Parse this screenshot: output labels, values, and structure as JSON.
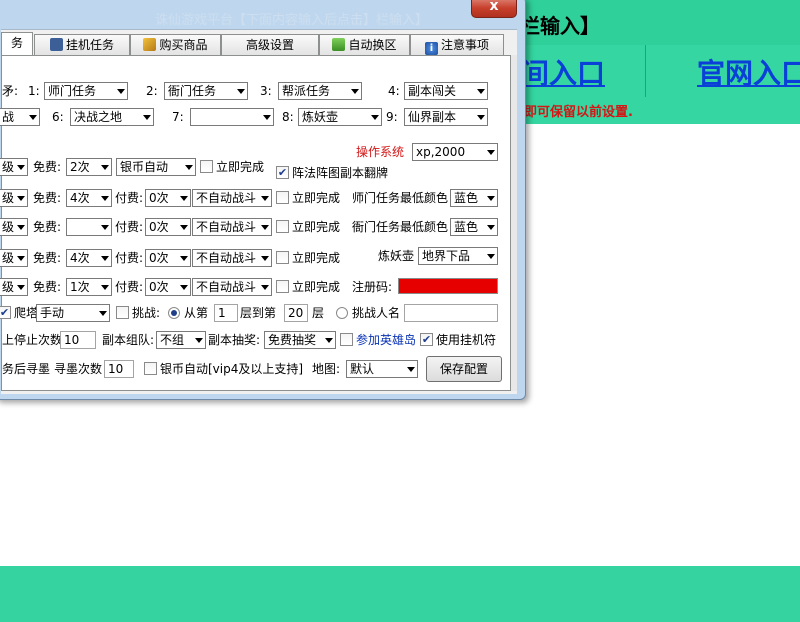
{
  "background": {
    "top_title": "栏输入】",
    "nav_link_1": "间入口",
    "nav_link_2": "官网入口",
    "notice": "即可保留以前设置."
  },
  "window": {
    "title": "诛仙游戏平台【下面内容输入后点击】栏输入】",
    "close_label": "x"
  },
  "tabs": [
    {
      "label": "务",
      "icon": ""
    },
    {
      "label": "挂机任务",
      "icon": "robot-icon"
    },
    {
      "label": "购买商品",
      "icon": "box-icon"
    },
    {
      "label": "高级设置",
      "icon": ""
    },
    {
      "label": "自动换区",
      "icon": "arrow-icon"
    },
    {
      "label": "注意事项",
      "icon": "info-icon"
    }
  ],
  "row1": {
    "prefix": "矛:",
    "n1": "1:",
    "v1": "师门任务",
    "n2": "2:",
    "v2": "衙门任务",
    "n3": "3:",
    "v3": "帮派任务",
    "n4": "4:",
    "v4": "副本闯关"
  },
  "row2": {
    "v5_tail": "战",
    "n6": "6:",
    "v6": "决战之地",
    "n7": "7:",
    "v7": "",
    "n8": "8:",
    "v8": "炼妖壶",
    "n9": "9:",
    "v9": "仙界副本"
  },
  "os": {
    "label": "操作系统",
    "value": "xp,2000"
  },
  "row3": {
    "level": "级",
    "free_label": "免费:",
    "free": "2次",
    "currency": "银币自动",
    "instant": "立即完成",
    "flip_label": "阵法阵图副本翻牌",
    "flip_checked": "✔"
  },
  "row4": {
    "level": "级",
    "free_label": "免费:",
    "free": "4次",
    "paid_label": "付费:",
    "paid": "0次",
    "fight": "不自动战斗",
    "instant": "立即完成",
    "color_label": "师门任务最低颜色",
    "color": "蓝色"
  },
  "row5": {
    "level": "级",
    "free_label": "免费:",
    "free": "",
    "paid_label": "付费:",
    "paid": "0次",
    "fight": "不自动战斗",
    "instant": "立即完成",
    "color_label": "衙门任务最低颜色",
    "color": "蓝色"
  },
  "row6": {
    "level": "级",
    "free_label": "免费:",
    "free": "4次",
    "paid_label": "付费:",
    "paid": "0次",
    "fight": "不自动战斗",
    "instant": "立即完成",
    "pot_label": "炼妖壶",
    "pot": "地界下品"
  },
  "row7": {
    "level": "级",
    "free_label": "免费:",
    "free": "1次",
    "paid_label": "付费:",
    "paid": "0次",
    "fight": "不自动战斗",
    "instant": "立即完成",
    "reg_label": "注册码:"
  },
  "row8": {
    "tower_check": "✔",
    "tower_label": "爬塔",
    "mode": "手动",
    "challenge_label": "挑战:",
    "from_label": "从第",
    "from_value": "1",
    "to_label": "层到第",
    "to_value": "20",
    "floor_label": "层",
    "name_label": "挑战人名",
    "name_value": ""
  },
  "row9": {
    "stop_label": "上停止次数:",
    "stop_value": "10",
    "team_label": "副本组队:",
    "team": "不组",
    "draw_label": "副本抽奖:",
    "draw": "免费抽奖",
    "hero_label": "参加英雄岛",
    "talisman_check": "✔",
    "talisman_label": "使用挂机符"
  },
  "row10": {
    "after_label": "务后寻墨",
    "find_label": "寻墨次数",
    "find_value": "10",
    "silver_label": "银币自动[vip4及以上支持]",
    "map_label": "地图:",
    "map": "默认",
    "save": "保存配置"
  }
}
